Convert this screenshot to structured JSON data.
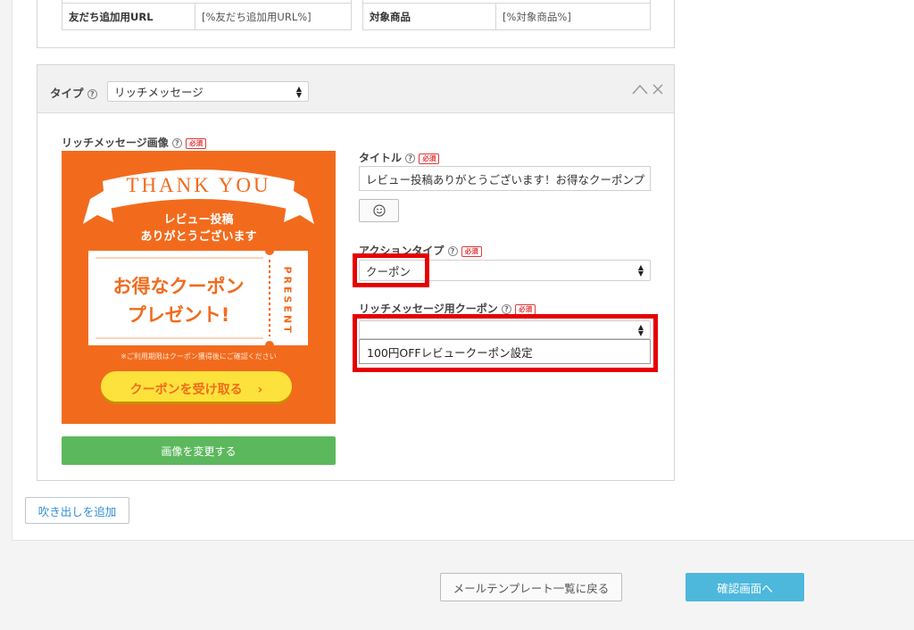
{
  "top_table": {
    "left_header": "友だち追加用URL",
    "left_value": "[%友だち追加用URL%]",
    "right_header": "対象商品",
    "right_value": "[%対象商品%]"
  },
  "bubble": {
    "type_label": "タイプ",
    "type_value": "リッチメッセージ",
    "image_label": "リッチメッセージ画像",
    "required": "必須",
    "change_image_label": "画像を変更する",
    "title_label": "タイトル",
    "title_value": "レビュー投稿ありがとうございます！お得なクーポンプ",
    "action_type_label": "アクションタイプ",
    "action_type_value": "クーポン",
    "coupon_label": "リッチメッセージ用クーポン",
    "coupon_value": "",
    "coupon_option": "100円OFFレビュークーポン設定"
  },
  "image": {
    "thank_you": "THANK YOU",
    "line1": "レビュー投稿",
    "line2": "ありがとうございます",
    "coupon_line1": "お得なクーポン",
    "coupon_line2": "プレゼント!",
    "present": "PRESENT",
    "note": "※ご利用期限はクーポン獲得後にご確認ください",
    "cta": "クーポンを受け取る"
  },
  "add_bubble_label": "吹き出しを追加",
  "back_button": "メールテンプレート一覧に戻る",
  "confirm_button": "確認画面へ",
  "colors": {
    "image_bg": "#f26b1d",
    "green": "#5cb85c",
    "confirm": "#4db8dc",
    "highlight": "#e60000"
  }
}
